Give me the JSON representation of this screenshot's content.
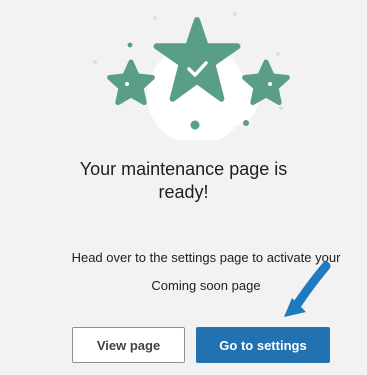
{
  "colors": {
    "star_green": "#5a9e86",
    "primary_blue": "#2271b1",
    "arrow_blue": "#1f7bc1",
    "background": "#f2f2f2"
  },
  "icons": {
    "illustration": "stars-with-check-icon",
    "pointer": "arrow-pointer-icon"
  },
  "content": {
    "title": "Your maintenance page is ready!",
    "description_line1": "Head over to the settings page to activate your",
    "description_line2": "Coming soon page"
  },
  "buttons": {
    "view_page": "View page",
    "go_to_settings": "Go to settings"
  }
}
